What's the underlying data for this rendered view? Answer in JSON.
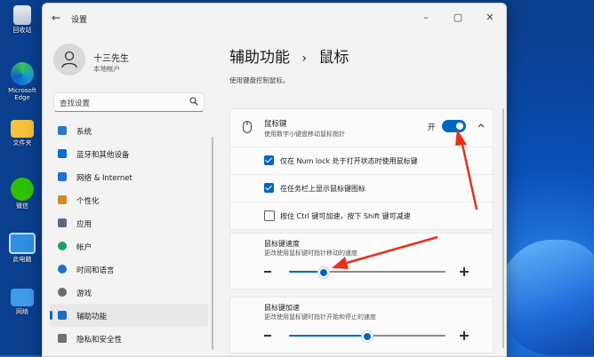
{
  "desktop": {
    "icons": [
      {
        "label": "回收站",
        "icon": "recycle-bin-icon"
      },
      {
        "label": "Microsoft Edge",
        "icon": "edge-icon"
      },
      {
        "label": "文件夹",
        "icon": "folder-icon"
      },
      {
        "label": "微信",
        "icon": "wechat-icon"
      },
      {
        "label": "此电脑",
        "icon": "computer-icon"
      },
      {
        "label": "网络",
        "icon": "network-icon"
      }
    ]
  },
  "window": {
    "title": "设置",
    "controls": {
      "minimize": "–",
      "maximize": "▢",
      "close": "✕"
    }
  },
  "user": {
    "name": "十三先生",
    "account_type": "本地帐户"
  },
  "search": {
    "placeholder": "查找设置"
  },
  "sidebar": {
    "items": [
      {
        "label": "系统",
        "icon": "monitor-icon",
        "color": "#2b78c5"
      },
      {
        "label": "蓝牙和其他设备",
        "icon": "bluetooth-icon",
        "color": "#0a6bd1"
      },
      {
        "label": "网络 & Internet",
        "icon": "wifi-icon",
        "color": "#1c6fd6"
      },
      {
        "label": "个性化",
        "icon": "brush-icon",
        "color": "#d08a2d"
      },
      {
        "label": "应用",
        "icon": "apps-icon",
        "color": "#5a6b80"
      },
      {
        "label": "帐户",
        "icon": "person-icon",
        "color": "#1e9e63"
      },
      {
        "label": "时间和语言",
        "icon": "globe-icon",
        "color": "#1573c8"
      },
      {
        "label": "游戏",
        "icon": "gamepad-icon",
        "color": "#6d6d6d"
      },
      {
        "label": "辅助功能",
        "icon": "accessibility-icon",
        "color": "#1a6fc0"
      },
      {
        "label": "隐私和安全性",
        "icon": "shield-icon",
        "color": "#6f6f6f"
      }
    ],
    "active_index": 8
  },
  "main": {
    "breadcrumb": {
      "parent": "辅助功能",
      "separator": "›",
      "current": "鼠标"
    },
    "description": "使用键盘控制鼠标。",
    "mouse_keys": {
      "title": "鼠标键",
      "subtitle": "使用数字小键盘移动鼠标指针",
      "toggle_state": "开",
      "enabled": true
    },
    "options": [
      {
        "label": "仅在 Num lock 处于打开状态时使用鼠标键",
        "checked": true
      },
      {
        "label": "在任务栏上显示鼠标键图标",
        "checked": true
      },
      {
        "label": "按住 Ctrl 键可加速，按下 Shift 键可减速",
        "checked": false
      }
    ],
    "sliders": [
      {
        "title": "鼠标键速度",
        "subtitle": "更改使用鼠标键时指针移动的速度",
        "value": 0.22
      },
      {
        "title": "鼠标键加速",
        "subtitle": "更改使用鼠标键时指针开始和停止的速度",
        "value": 0.5
      }
    ]
  },
  "colors": {
    "accent": "#0067c0",
    "annotation": "#e8301c"
  }
}
